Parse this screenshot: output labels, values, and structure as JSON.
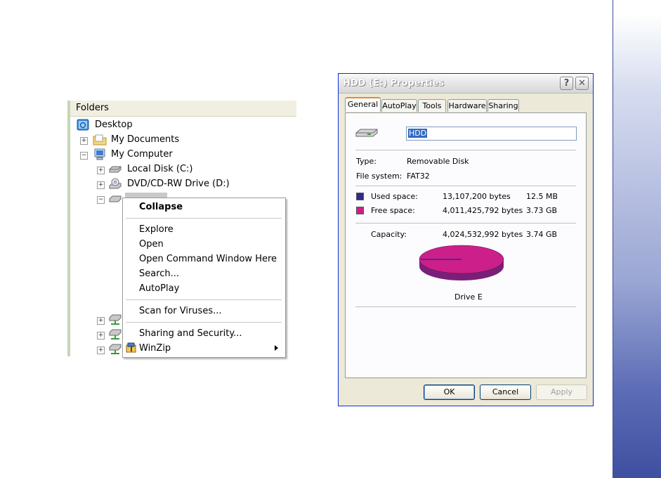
{
  "explorer": {
    "header": "Folders",
    "items": [
      {
        "label": "Desktop",
        "icon": "desktop-icon"
      },
      {
        "label": "My Documents",
        "icon": "folder-icon"
      },
      {
        "label": "My Computer",
        "icon": "computer-icon"
      },
      {
        "label": "Local Disk (C:)",
        "icon": "drive-icon"
      },
      {
        "label": "DVD/CD-RW Drive (D:)",
        "icon": "cd-drive-icon"
      }
    ]
  },
  "context_menu": {
    "items": [
      "Collapse",
      "Explore",
      "Open",
      "Open Command Window Here",
      "Search...",
      "AutoPlay",
      "Scan for Viruses...",
      "Sharing and Security...",
      "WinZip"
    ]
  },
  "dialog": {
    "title": "HDD (E:) Properties",
    "help": "?",
    "close": "✕",
    "tabs": [
      "General",
      "AutoPlay",
      "Tools",
      "Hardware",
      "Sharing"
    ],
    "name_value": "HDD",
    "type_label": "Type:",
    "type_value": "Removable Disk",
    "fs_label": "File system:",
    "fs_value": "FAT32",
    "used_label": "Used space:",
    "used_bytes": "13,107,200 bytes",
    "used_size": "12.5 MB",
    "free_label": "Free space:",
    "free_bytes": "4,011,425,792 bytes",
    "free_size": "3.73 GB",
    "capacity_label": "Capacity:",
    "capacity_bytes": "4,024,532,992 bytes",
    "capacity_size": "3.74 GB",
    "drive_label": "Drive E",
    "used_fraction": 0.0033,
    "colors": {
      "used": "#2e2a8c",
      "free": "#cc1f8a",
      "free_dark": "#7a1f78"
    },
    "buttons": {
      "ok": "OK",
      "cancel": "Cancel",
      "apply": "Apply"
    }
  }
}
